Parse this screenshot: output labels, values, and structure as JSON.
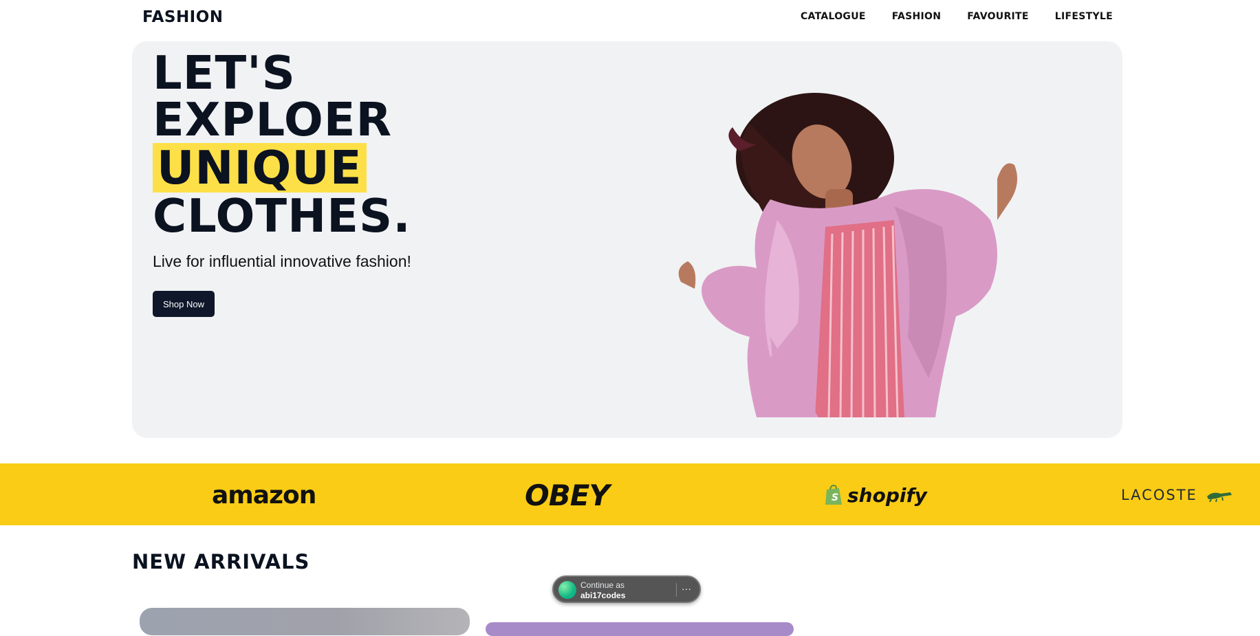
{
  "brand": "FASHION",
  "nav": [
    "CATALOGUE",
    "FASHION",
    "FAVOURITE",
    "LIFESTYLE"
  ],
  "hero": {
    "lines": [
      "LET'S",
      "EXPLOER",
      "UNIQUE",
      "CLOTHES."
    ],
    "subtitle": "Live for influential innovative fashion!",
    "cta": "Shop Now",
    "accent": "#fde047"
  },
  "brands": [
    "amazon",
    "OBEY",
    "shopify",
    "LACOSTE"
  ],
  "sections": {
    "new_arrivals": "NEW ARRIVALS"
  },
  "toast": {
    "line1": "Continue as",
    "line2": "abi17codes",
    "more": "···"
  },
  "colors": {
    "dark": "#0b1220",
    "brand_band": "#facc15",
    "hero_bg": "#f1f2f4"
  }
}
